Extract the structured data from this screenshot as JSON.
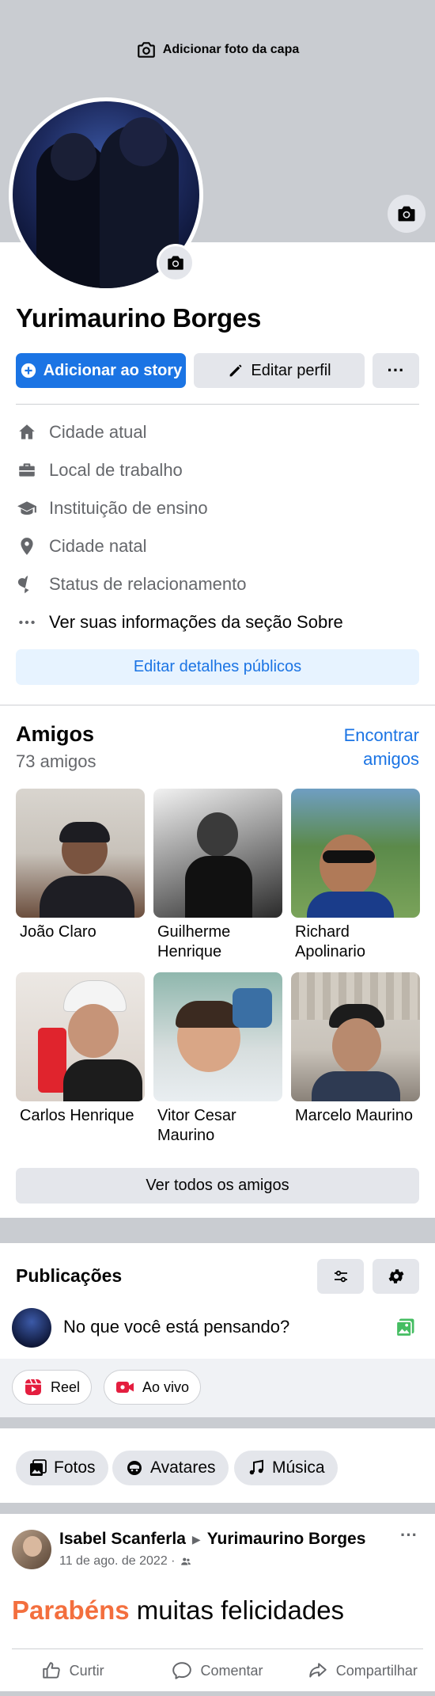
{
  "cover": {
    "add_cover_label": "Adicionar foto da capa"
  },
  "profile": {
    "name": "Yurimaurino Borges",
    "add_story_label": "Adicionar ao story",
    "edit_profile_label": "Editar perfil",
    "more_label": "···"
  },
  "details": [
    {
      "icon": "home-icon",
      "text": "Cidade atual"
    },
    {
      "icon": "briefcase-icon",
      "text": "Local de trabalho"
    },
    {
      "icon": "graduation-cap-icon",
      "text": "Instituição de ensino"
    },
    {
      "icon": "location-pin-icon",
      "text": "Cidade natal"
    },
    {
      "icon": "heart-icon",
      "text": "Status de relacionamento"
    },
    {
      "icon": "ellipsis-icon",
      "text": "Ver suas informações da seção Sobre"
    }
  ],
  "edit_public_label": "Editar detalhes públicos",
  "friends": {
    "title": "Amigos",
    "count": "73 amigos",
    "find_label": "Encontrar amigos",
    "see_all_label": "Ver todos os amigos",
    "list": [
      {
        "name": "João Claro"
      },
      {
        "name": "Guilherme Henrique"
      },
      {
        "name": "Richard Apolinario"
      },
      {
        "name": "Carlos Henrique"
      },
      {
        "name": "Vitor Cesar Maurino"
      },
      {
        "name": "Marcelo Maurino"
      }
    ]
  },
  "publications": {
    "title": "Publicações",
    "composer_placeholder": "No que você está pensando?",
    "reel_label": "Reel",
    "live_label": "Ao vivo",
    "chips": [
      "Fotos",
      "Avatares",
      "Música"
    ]
  },
  "post": {
    "author": "Isabel Scanferla",
    "target": "Yurimaurino Borges",
    "date": "11 de ago. de 2022 ·",
    "text_highlight": "Parabéns",
    "text_rest": " muitas felicidades",
    "more_label": "···",
    "like_label": "Curtir",
    "comment_label": "Comentar",
    "share_label": "Compartilhar"
  },
  "colors": {
    "accent": "#1b74e4",
    "cover_gray": "#c9ccd1",
    "button_gray": "#e4e6eb",
    "muted_text": "#65676b",
    "highlight_orange": "#f36f3e"
  }
}
